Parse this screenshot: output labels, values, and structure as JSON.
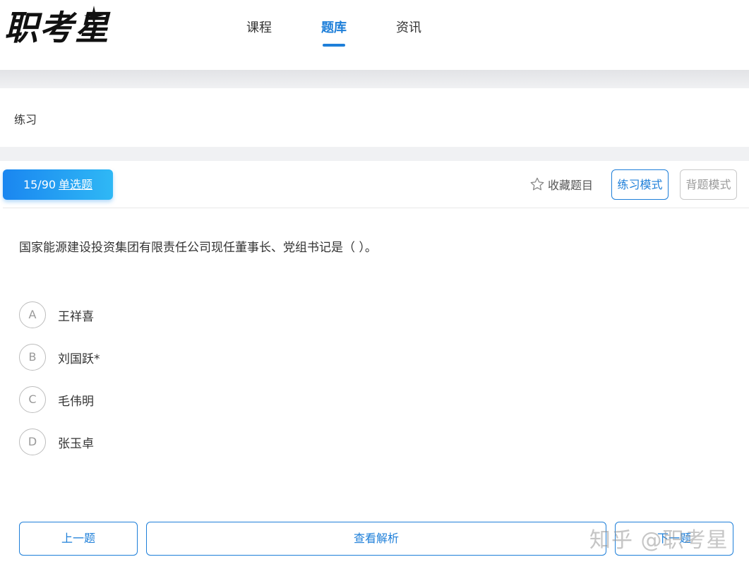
{
  "header": {
    "logo_text": "职考星",
    "nav": [
      {
        "label": "课程"
      },
      {
        "label": "题库",
        "active": true
      },
      {
        "label": "资讯"
      }
    ]
  },
  "breadcrumb": "练习",
  "question_tag": {
    "progress": "15/90",
    "type": "单选题"
  },
  "toolbar": {
    "favorite_label": "收藏题目",
    "favorite_icon": "star-icon",
    "practice_mode_label": "练习模式",
    "recite_mode_label": "背题模式"
  },
  "question": {
    "text": "国家能源建设投资集团有限责任公司现任董事长、党组书记是（ ）。",
    "options": [
      {
        "letter": "A",
        "text": "王祥喜"
      },
      {
        "letter": "B",
        "text": "刘国跃*"
      },
      {
        "letter": "C",
        "text": "毛伟明"
      },
      {
        "letter": "D",
        "text": "张玉卓"
      }
    ]
  },
  "buttons": {
    "prev": "上一题",
    "analysis": "查看解析",
    "next": "下一题"
  },
  "watermark": "知乎 @职考星",
  "colors": {
    "accent": "#1e7fd9",
    "tag_gradient_start": "#1a86f0",
    "tag_gradient_end": "#2fb8f5"
  }
}
